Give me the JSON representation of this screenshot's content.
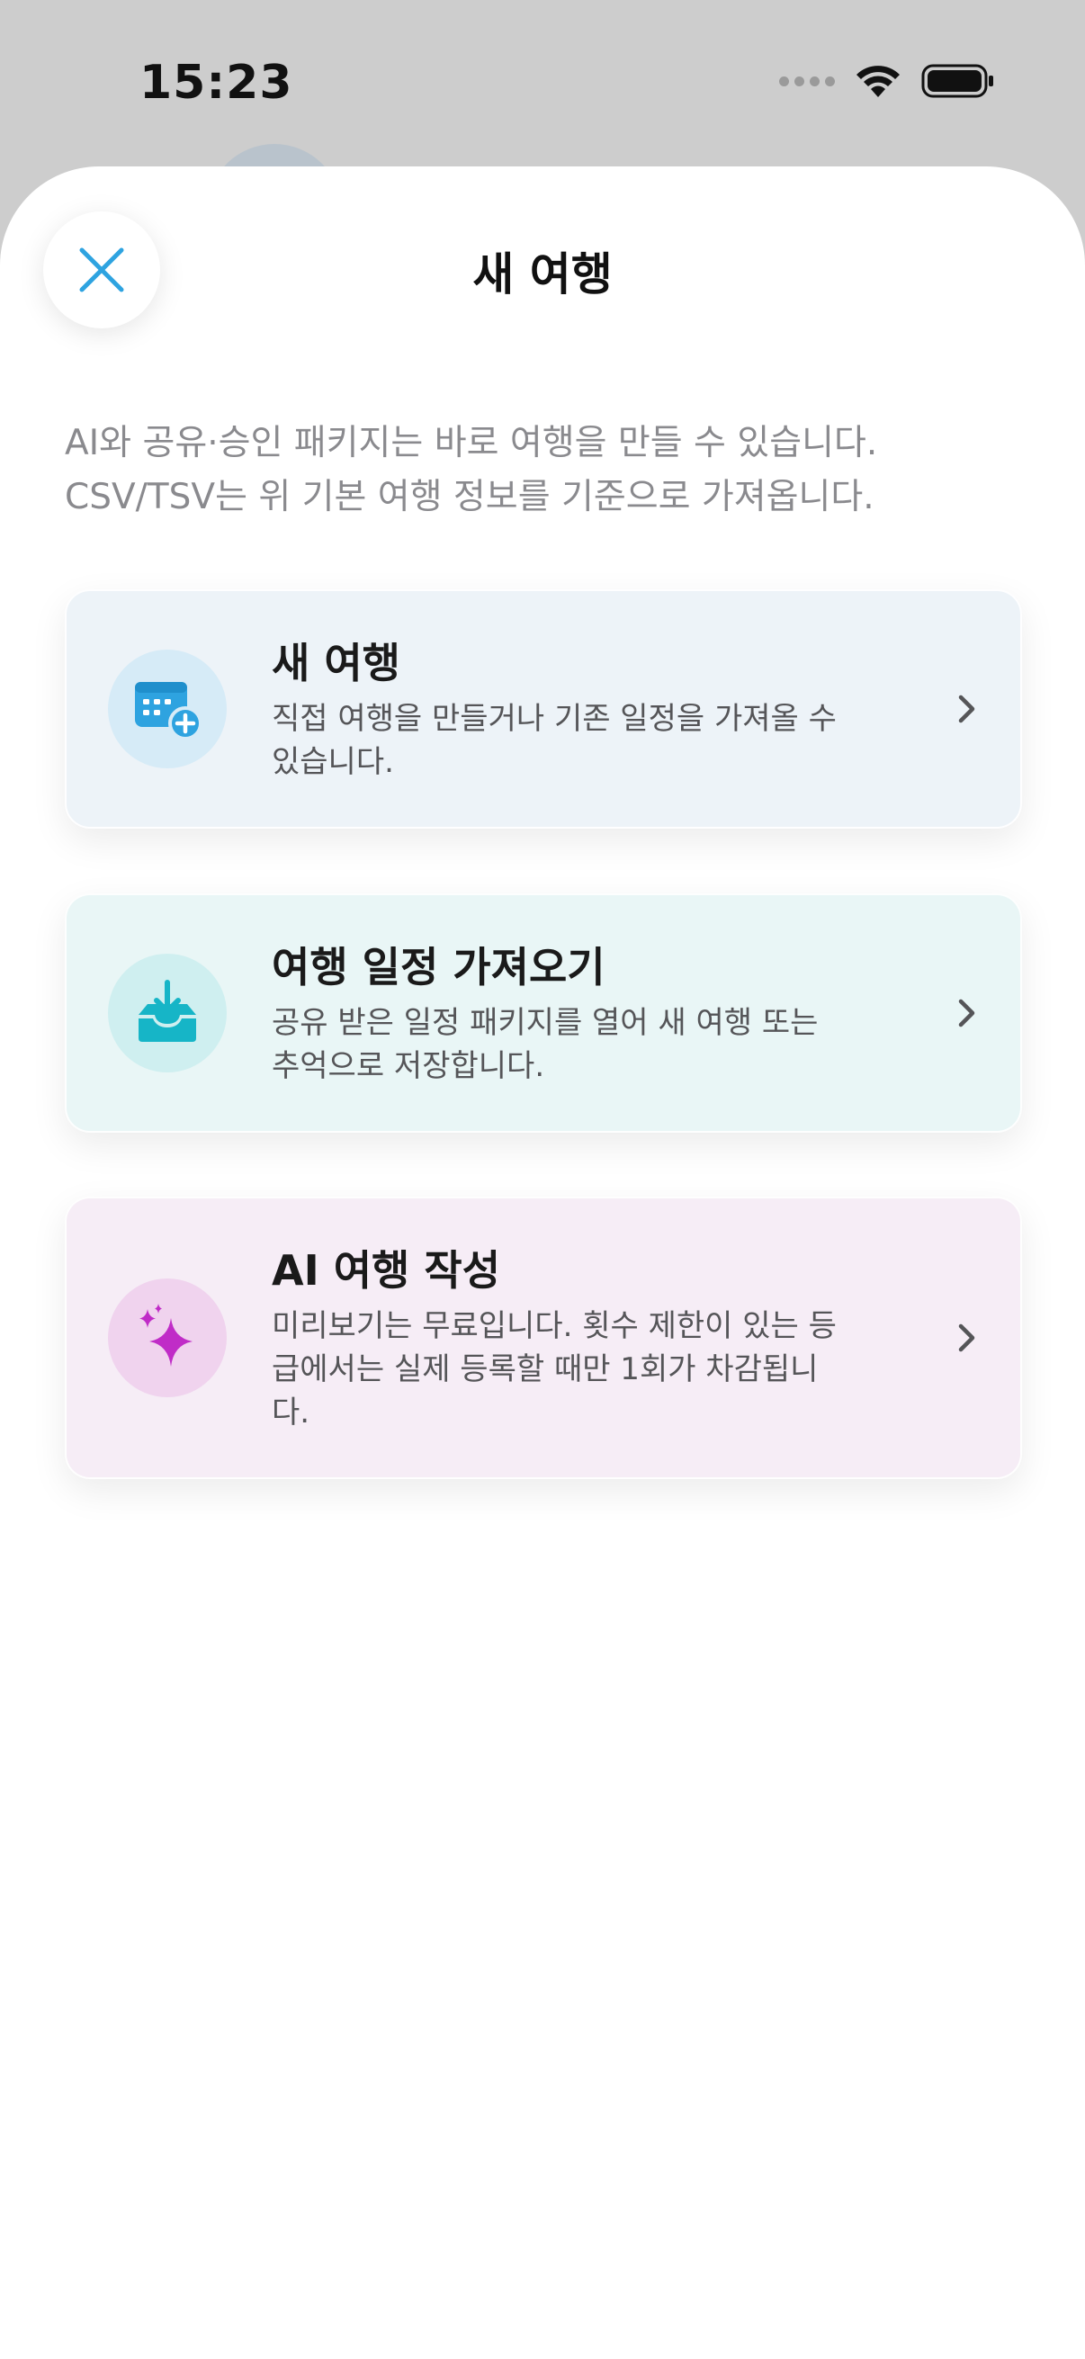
{
  "status_bar": {
    "time": "15:23"
  },
  "sheet": {
    "title": "새 여행",
    "intro_lines": [
      "AI와 공유·승인 패키지는 바로 여행을 만들 수 있습니다.",
      "CSV/TSV는 위 기본 여행 정보를 기준으로 가져옵니다."
    ]
  },
  "options": [
    {
      "title": "새 여행",
      "description": "직접 여행을 만들거나 기존 일정을 가져올 수 있습니다.",
      "icon": "calendar-add-icon",
      "icon_color": "#2ea3e0"
    },
    {
      "title": "여행 일정 가져오기",
      "description": "공유 받은 일정 패키지를 열어 새 여행 또는 추억으로 저장합니다.",
      "icon": "tray-download-icon",
      "icon_color": "#16b5c7"
    },
    {
      "title": "AI 여행 작성",
      "description": "미리보기는 무료입니다. 횟수 제한이 있는 등급에서는 실제 등록할 때만 1회가 차감됩니다.",
      "icon": "sparkles-icon",
      "icon_color": "#c02cc7"
    }
  ],
  "colors": {
    "accent": "#2ea3e0",
    "card_new_bg": "#edf3f8",
    "card_import_bg": "#e9f6f6",
    "card_ai_bg": "#f6edf6"
  }
}
